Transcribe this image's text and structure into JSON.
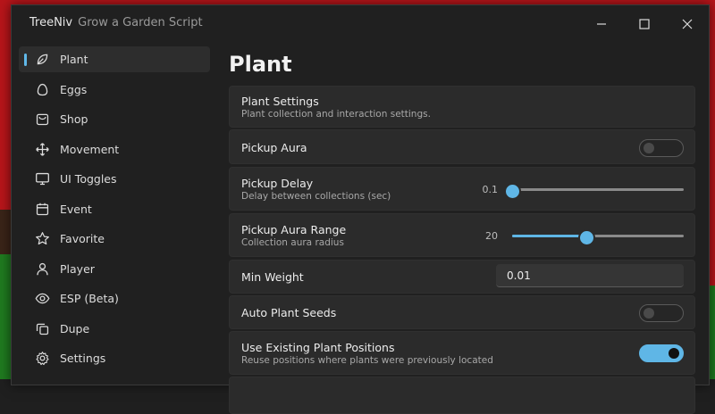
{
  "colors": {
    "accent": "#5fb6e6",
    "window_bg": "#202020",
    "card_bg": "#2b2b2b"
  },
  "window": {
    "title": "TreeNiv",
    "subtitle": "Grow a Garden Script"
  },
  "controls": {
    "minimize_icon": "minimize-icon",
    "maximize_icon": "maximize-icon",
    "close_icon": "close-icon"
  },
  "sidebar": {
    "items": [
      {
        "label": "Plant",
        "icon": "leaf-icon",
        "active": true
      },
      {
        "label": "Eggs",
        "icon": "egg-icon"
      },
      {
        "label": "Shop",
        "icon": "shopping-bag-icon"
      },
      {
        "label": "Movement",
        "icon": "move-arrows-icon"
      },
      {
        "label": "UI Toggles",
        "icon": "monitor-icon"
      },
      {
        "label": "Event",
        "icon": "calendar-icon"
      },
      {
        "label": "Favorite",
        "icon": "star-icon"
      },
      {
        "label": "Player",
        "icon": "person-icon"
      },
      {
        "label": "ESP (Beta)",
        "icon": "eye-icon"
      },
      {
        "label": "Dupe",
        "icon": "copy-icon"
      },
      {
        "label": "Settings",
        "icon": "gear-icon"
      }
    ]
  },
  "main": {
    "page_title": "Plant",
    "plant_settings": {
      "label": "Plant Settings",
      "desc": "Plant collection and interaction settings."
    },
    "pickup_aura": {
      "label": "Pickup Aura",
      "enabled": false
    },
    "pickup_delay": {
      "label": "Pickup Delay",
      "desc": "Delay between collections (sec)",
      "value": "0.1",
      "fraction": 0.0
    },
    "pickup_aura_range": {
      "label": "Pickup Aura Range",
      "desc": "Collection aura radius",
      "value": "20",
      "fraction": 0.43
    },
    "min_weight": {
      "label": "Min Weight",
      "value": "0.01"
    },
    "auto_plant_seeds": {
      "label": "Auto Plant Seeds",
      "enabled": false
    },
    "use_existing_positions": {
      "label": "Use Existing Plant Positions",
      "desc": "Reuse positions where plants were previously located",
      "enabled": true
    }
  }
}
